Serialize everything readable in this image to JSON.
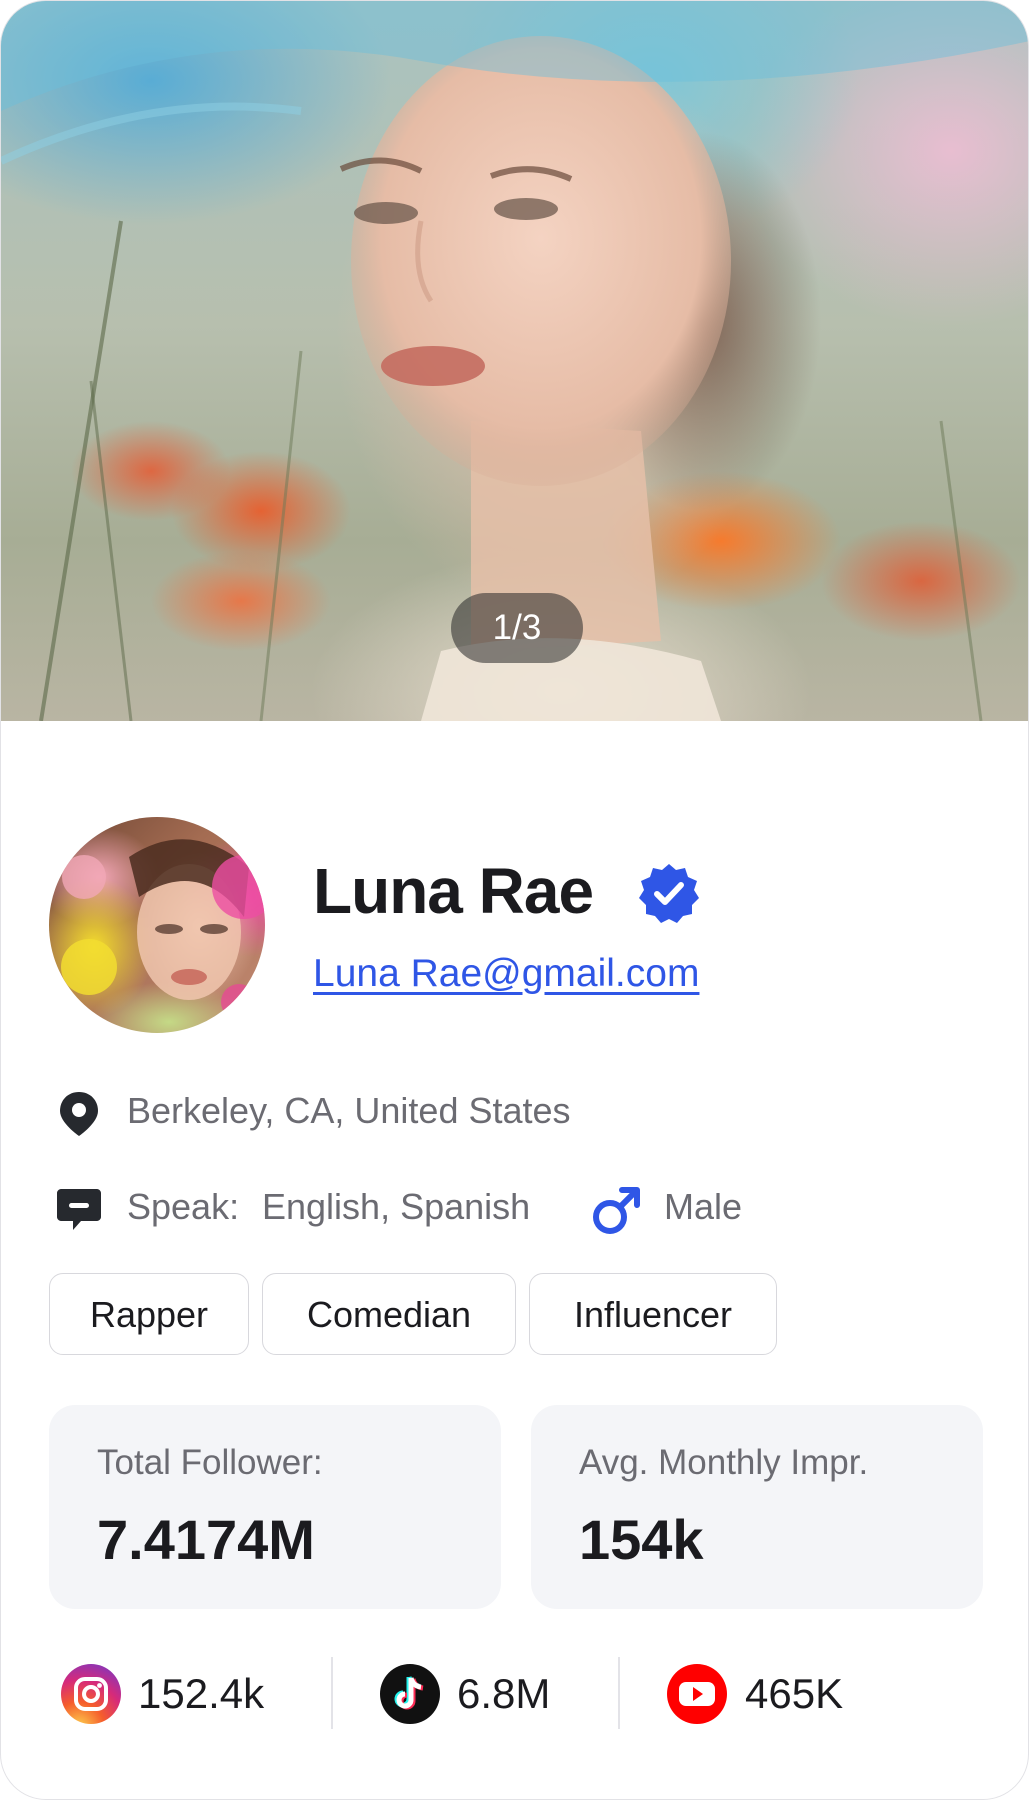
{
  "hero": {
    "pager": "1/3"
  },
  "profile": {
    "name": "Luna Rae",
    "email": "Luna Rae@gmail.com",
    "location": "Berkeley, CA, United States",
    "speak_label": "Speak:",
    "languages": "English, Spanish",
    "gender": "Male"
  },
  "tags": [
    "Rapper",
    "Comedian",
    "Influencer"
  ],
  "stats": {
    "followers_label": "Total Follower:",
    "followers_value": "7.4174M",
    "impressions_label": "Avg. Monthly Impr.",
    "impressions_value": "154k"
  },
  "social": {
    "instagram": "152.4k",
    "tiktok": "6.8M",
    "youtube": "465K"
  },
  "colors": {
    "accent_blue": "#2f56e6",
    "text_dark": "#1b1b1f",
    "text_muted": "#6b6b72",
    "stat_bg": "#f4f5f8",
    "youtube_red": "#ff0000"
  },
  "icons": [
    "verified-badge-icon",
    "location-pin-icon",
    "chat-icon",
    "male-gender-icon",
    "instagram-icon",
    "tiktok-icon",
    "youtube-icon"
  ]
}
